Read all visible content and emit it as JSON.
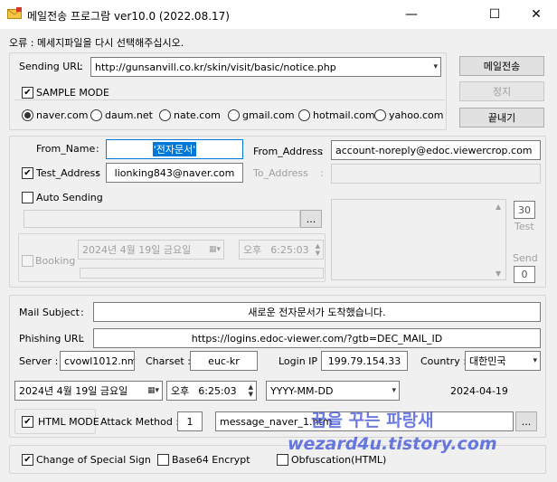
{
  "window": {
    "title": "메일전송 프로그람 ver10.0 (2022.08.17)",
    "minimize": "—",
    "maximize": "☐",
    "close": "✕"
  },
  "error_text": "오류 : 메세지파일을 다시 선택해주십시오.",
  "sending_url": {
    "label": "Sending URL",
    "colon": ":",
    "value": "http://gunsanvill.co.kr/skin/visit/basic/notice.php"
  },
  "buttons": {
    "send": "메일전송",
    "stop": "정지",
    "exit": "끝내기"
  },
  "sample_mode": {
    "label": "SAMPLE MODE",
    "checked": true,
    "options": [
      "naver.com",
      "daum.net",
      "nate.com",
      "gmail.com",
      "hotmail.com",
      "yahoo.com"
    ],
    "selected": "naver.com"
  },
  "from_name": {
    "label": "From_Name",
    "colon": ":",
    "value": "'전자문서'"
  },
  "from_address": {
    "label": "From_Address",
    "colon": ":",
    "value": "account-noreply@edoc.viewercrop.com"
  },
  "test_address": {
    "label": "Test_Address",
    "colon": ":",
    "value": "lionking843@naver.com",
    "checked": true
  },
  "to_address": {
    "label": "To_Address",
    "colon": ":"
  },
  "auto_sending": {
    "label": "Auto Sending",
    "browse": "..."
  },
  "counters": {
    "test_value": "30",
    "test_label": "Test",
    "send_label": "Send",
    "send_value": "0"
  },
  "booking": {
    "label": "Booking",
    "date": "2024년   4월 19일 금요일",
    "ampm": "오후",
    "time": "6:25:03"
  },
  "mail_subject": {
    "label": "Mail Subject",
    "colon": ":",
    "value": "새로운 전자문서가 도착했습니다."
  },
  "phishing_url": {
    "label": "Phishing URL",
    "colon": ":",
    "value": "https://logins.edoc-viewer.com/?gtb=DEC_MAIL_ID"
  },
  "server": {
    "label": "Server :",
    "value": "cvowl1012.nm"
  },
  "charset": {
    "label": "Charset :",
    "value": "euc-kr"
  },
  "login_ip": {
    "label": "Login IP :",
    "value": "199.79.154.33"
  },
  "country": {
    "label": "Country :",
    "value": "대한민국"
  },
  "datetime": {
    "date": "2024년   4월 19일 금요일",
    "ampm": "오후",
    "time": "6:25:03",
    "format": "YYYY-MM-DD",
    "preview": "2024-04-19"
  },
  "html_mode": {
    "label": "HTML MODE",
    "checked": true
  },
  "attack_method": {
    "label": "Attack Method :",
    "value": "1"
  },
  "message_file": {
    "value": "message_naver_1.htm",
    "browse": "..."
  },
  "options": {
    "special_sign": {
      "label": "Change of Special Sign",
      "checked": true
    },
    "base64": {
      "label": "Base64 Encrypt",
      "checked": false
    },
    "obfuscation": {
      "label": "Obfuscation(HTML)",
      "checked": false
    }
  },
  "watermark": {
    "korean": "꿈을 꾸는 파랑새",
    "url": "wezard4u.tistory.com"
  },
  "colors": {
    "selection": "#0078d7",
    "watermark": "#3b4fd8",
    "window_bg": "#f0f0f0"
  }
}
